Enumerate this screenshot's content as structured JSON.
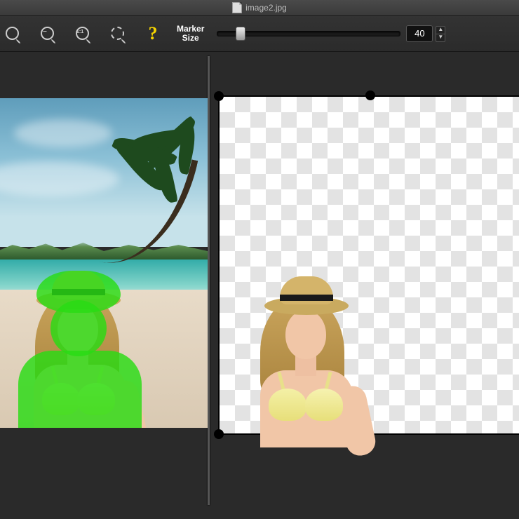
{
  "titlebar": {
    "filename": "image2.jpg"
  },
  "toolbar": {
    "zoom_out_icon": "−",
    "zoom_11_icon": "1:1",
    "marker_label_line1": "Marker",
    "marker_label_line2": "Size",
    "marker_value": "40",
    "step_up": "▲",
    "step_down": "▼"
  }
}
